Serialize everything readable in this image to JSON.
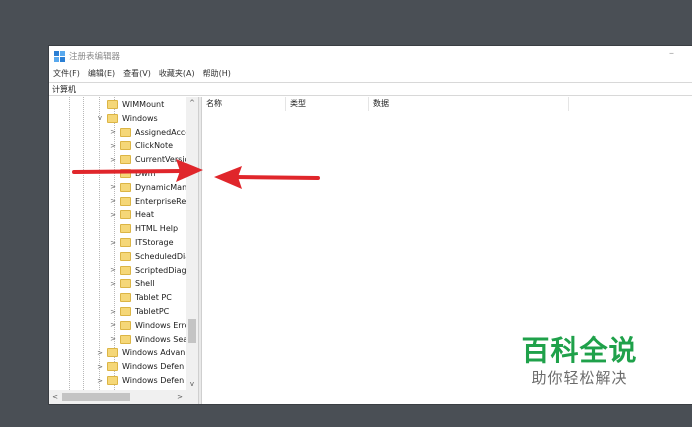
{
  "window": {
    "title": "注册表编辑器",
    "minimize_glyph": "–"
  },
  "menu": [
    {
      "label": "文件(F)"
    },
    {
      "label": "编辑(E)"
    },
    {
      "label": "查看(V)"
    },
    {
      "label": "收藏夹(A)"
    },
    {
      "label": "帮助(H)"
    }
  ],
  "address": {
    "path": "计算机"
  },
  "tree": {
    "nodes": [
      {
        "label": "WIMMount",
        "expander": "",
        "depth": 0
      },
      {
        "label": "Windows",
        "expander": "v",
        "depth": 0
      },
      {
        "label": "AssignedAcce",
        "expander": ">",
        "depth": 1
      },
      {
        "label": "ClickNote",
        "expander": ">",
        "depth": 1
      },
      {
        "label": "CurrentVersio",
        "expander": ">",
        "depth": 1
      },
      {
        "label": "Dwm",
        "expander": "",
        "depth": 1
      },
      {
        "label": "DynamicMan",
        "expander": ">",
        "depth": 1
      },
      {
        "label": "EnterpriseRes",
        "expander": ">",
        "depth": 1
      },
      {
        "label": "Heat",
        "expander": ">",
        "depth": 1
      },
      {
        "label": "HTML Help",
        "expander": "",
        "depth": 1
      },
      {
        "label": "ITStorage",
        "expander": ">",
        "depth": 1
      },
      {
        "label": "ScheduledDia",
        "expander": "",
        "depth": 1
      },
      {
        "label": "ScriptedDiag",
        "expander": ">",
        "depth": 1
      },
      {
        "label": "Shell",
        "expander": ">",
        "depth": 1
      },
      {
        "label": "Tablet PC",
        "expander": "",
        "depth": 1
      },
      {
        "label": "TabletPC",
        "expander": ">",
        "depth": 1
      },
      {
        "label": "Windows Erro",
        "expander": ">",
        "depth": 1
      },
      {
        "label": "Windows Sea",
        "expander": ">",
        "depth": 1
      },
      {
        "label": "Windows Advan",
        "expander": ">",
        "depth": 0
      },
      {
        "label": "Windows Defen",
        "expander": ">",
        "depth": 0
      },
      {
        "label": "Windows Defen",
        "expander": ">",
        "depth": 0
      }
    ]
  },
  "list": {
    "columns": [
      {
        "label": "名称"
      },
      {
        "label": "类型"
      },
      {
        "label": "数据"
      }
    ]
  },
  "scroll": {
    "up": "^",
    "down": "v",
    "left": "<",
    "right": ">"
  },
  "watermark": {
    "brand": "百科全说",
    "slogan": "助你轻松解决"
  },
  "colors": {
    "arrow": "#e0262b",
    "folder": "#f5d778",
    "watermark": "#1fa14a",
    "background": "#4a4f55"
  },
  "icons": {
    "app": "regedit-icon",
    "folder": "folder-icon"
  }
}
